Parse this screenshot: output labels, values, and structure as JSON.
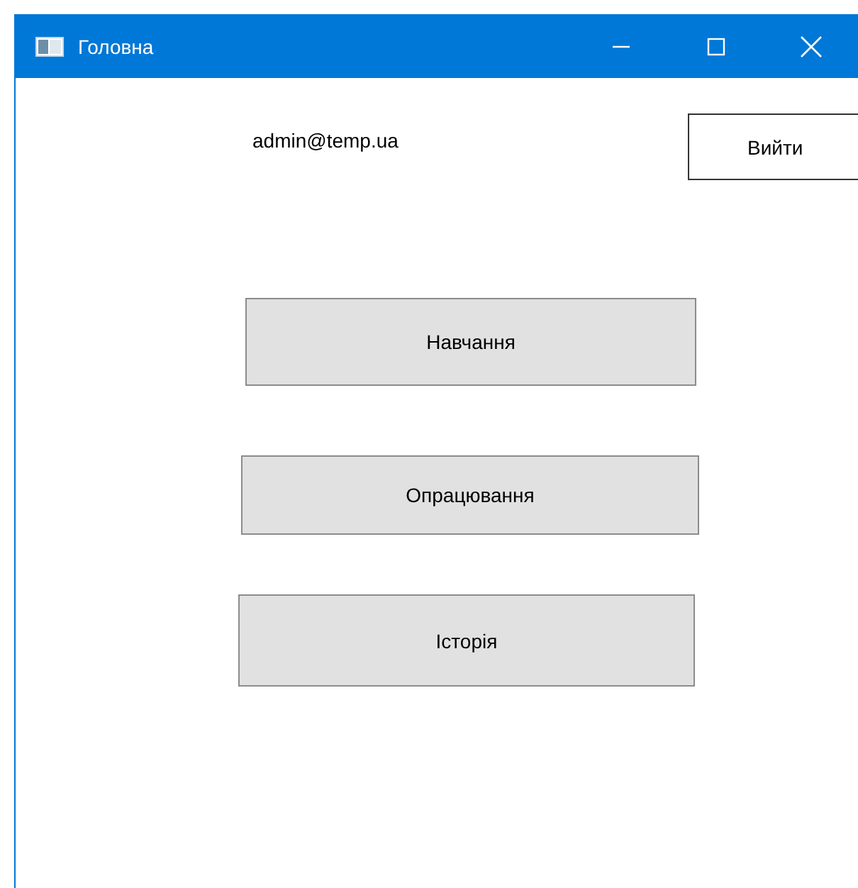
{
  "window": {
    "title": "Головна"
  },
  "user": {
    "email": "admin@temp.ua"
  },
  "logout_button": {
    "label": "Вийти"
  },
  "menu_buttons": [
    {
      "label": "Навчання"
    },
    {
      "label": "Опрацювання"
    },
    {
      "label": "Історія"
    }
  ]
}
